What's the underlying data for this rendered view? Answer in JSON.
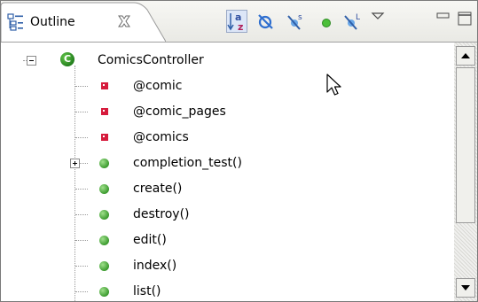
{
  "view": {
    "title": "Outline",
    "icon": "outline-view-icon",
    "close_icon": "close-tab-icon"
  },
  "toolbar": {
    "buttons": [
      {
        "name": "sort-alphabetically-button",
        "icon": "sort-az-icon",
        "pressed": true
      },
      {
        "name": "hide-fields-button",
        "icon": "hide-fields-icon"
      },
      {
        "name": "hide-static-members-button",
        "icon": "hide-static-icon"
      },
      {
        "name": "hide-non-public-button",
        "icon": "public-member-icon"
      },
      {
        "name": "hide-local-types-button",
        "icon": "hide-local-types-icon"
      },
      {
        "name": "view-menu-button",
        "icon": "triangle-down-icon"
      },
      {
        "name": "minimize-button",
        "icon": "minimize-icon"
      },
      {
        "name": "maximize-button",
        "icon": "maximize-icon"
      }
    ]
  },
  "tree": {
    "root": {
      "label": "ComicsController",
      "icon": "class-icon",
      "expanded": true
    },
    "items": [
      {
        "label": "@comic",
        "icon": "field-icon"
      },
      {
        "label": "@comic_pages",
        "icon": "field-icon"
      },
      {
        "label": "@comics",
        "icon": "field-icon"
      },
      {
        "label": "completion_test()",
        "icon": "method-icon",
        "collapsed": true
      },
      {
        "label": "create()",
        "icon": "method-icon"
      },
      {
        "label": "destroy()",
        "icon": "method-icon"
      },
      {
        "label": "edit()",
        "icon": "method-icon"
      },
      {
        "label": "index()",
        "icon": "method-icon"
      },
      {
        "label": "list()",
        "icon": "method-icon"
      }
    ]
  },
  "colors": {
    "field": "#d61b3c",
    "method": "#3b9a2e",
    "class": "#1f7a1a"
  }
}
